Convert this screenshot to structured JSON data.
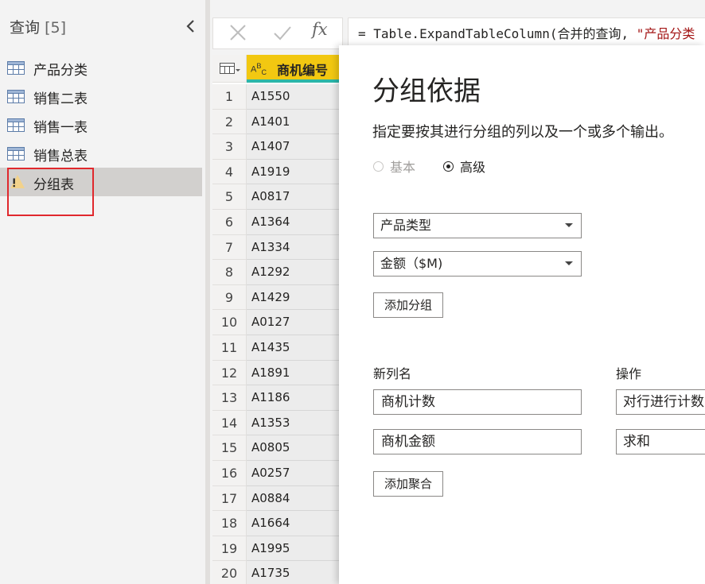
{
  "query_pane": {
    "title": "查询",
    "count": "[5]",
    "items": [
      {
        "label": "产品分类",
        "icon": "table-icon"
      },
      {
        "label": "销售二表",
        "icon": "table-icon"
      },
      {
        "label": "销售一表",
        "icon": "table-icon"
      },
      {
        "label": "销售总表",
        "icon": "table-icon"
      },
      {
        "label": "分组表",
        "icon": "warning-icon",
        "selected": true
      }
    ],
    "highlight_color": "#e0282d"
  },
  "formula_bar": {
    "fx_symbol": "fx",
    "prefix": "= Table.ExpandTableColumn(合并的查询, ",
    "string_part": "\"产品分类"
  },
  "grid": {
    "column_header": "商机编号",
    "type_icon": "ABC",
    "header_color": "#f2c811",
    "rows": [
      {
        "n": "1",
        "v": "A1550"
      },
      {
        "n": "2",
        "v": "A1401"
      },
      {
        "n": "3",
        "v": "A1407"
      },
      {
        "n": "4",
        "v": "A1919"
      },
      {
        "n": "5",
        "v": "A0817"
      },
      {
        "n": "6",
        "v": "A1364"
      },
      {
        "n": "7",
        "v": "A1334"
      },
      {
        "n": "8",
        "v": "A1292"
      },
      {
        "n": "9",
        "v": "A1429"
      },
      {
        "n": "10",
        "v": "A0127"
      },
      {
        "n": "11",
        "v": "A1435"
      },
      {
        "n": "12",
        "v": "A1891"
      },
      {
        "n": "13",
        "v": "A1186"
      },
      {
        "n": "14",
        "v": "A1353"
      },
      {
        "n": "15",
        "v": "A0805"
      },
      {
        "n": "16",
        "v": "A0257"
      },
      {
        "n": "17",
        "v": "A0884"
      },
      {
        "n": "18",
        "v": "A1664"
      },
      {
        "n": "19",
        "v": "A1995"
      },
      {
        "n": "20",
        "v": "A1735"
      }
    ]
  },
  "dialog": {
    "title": "分组依据",
    "description": "指定要按其进行分组的列以及一个或多个输出。",
    "radio_basic": "基本",
    "radio_advanced": "高级",
    "group_by_1": "产品类型",
    "group_by_2": "金额（$M)",
    "add_group_button": "添加分组",
    "new_col_label": "新列名",
    "operation_label": "操作",
    "agg_rows": [
      {
        "name": "商机计数",
        "op": "对行进行计数"
      },
      {
        "name": "商机金额",
        "op": "求和"
      }
    ],
    "add_agg_button": "添加聚合"
  }
}
